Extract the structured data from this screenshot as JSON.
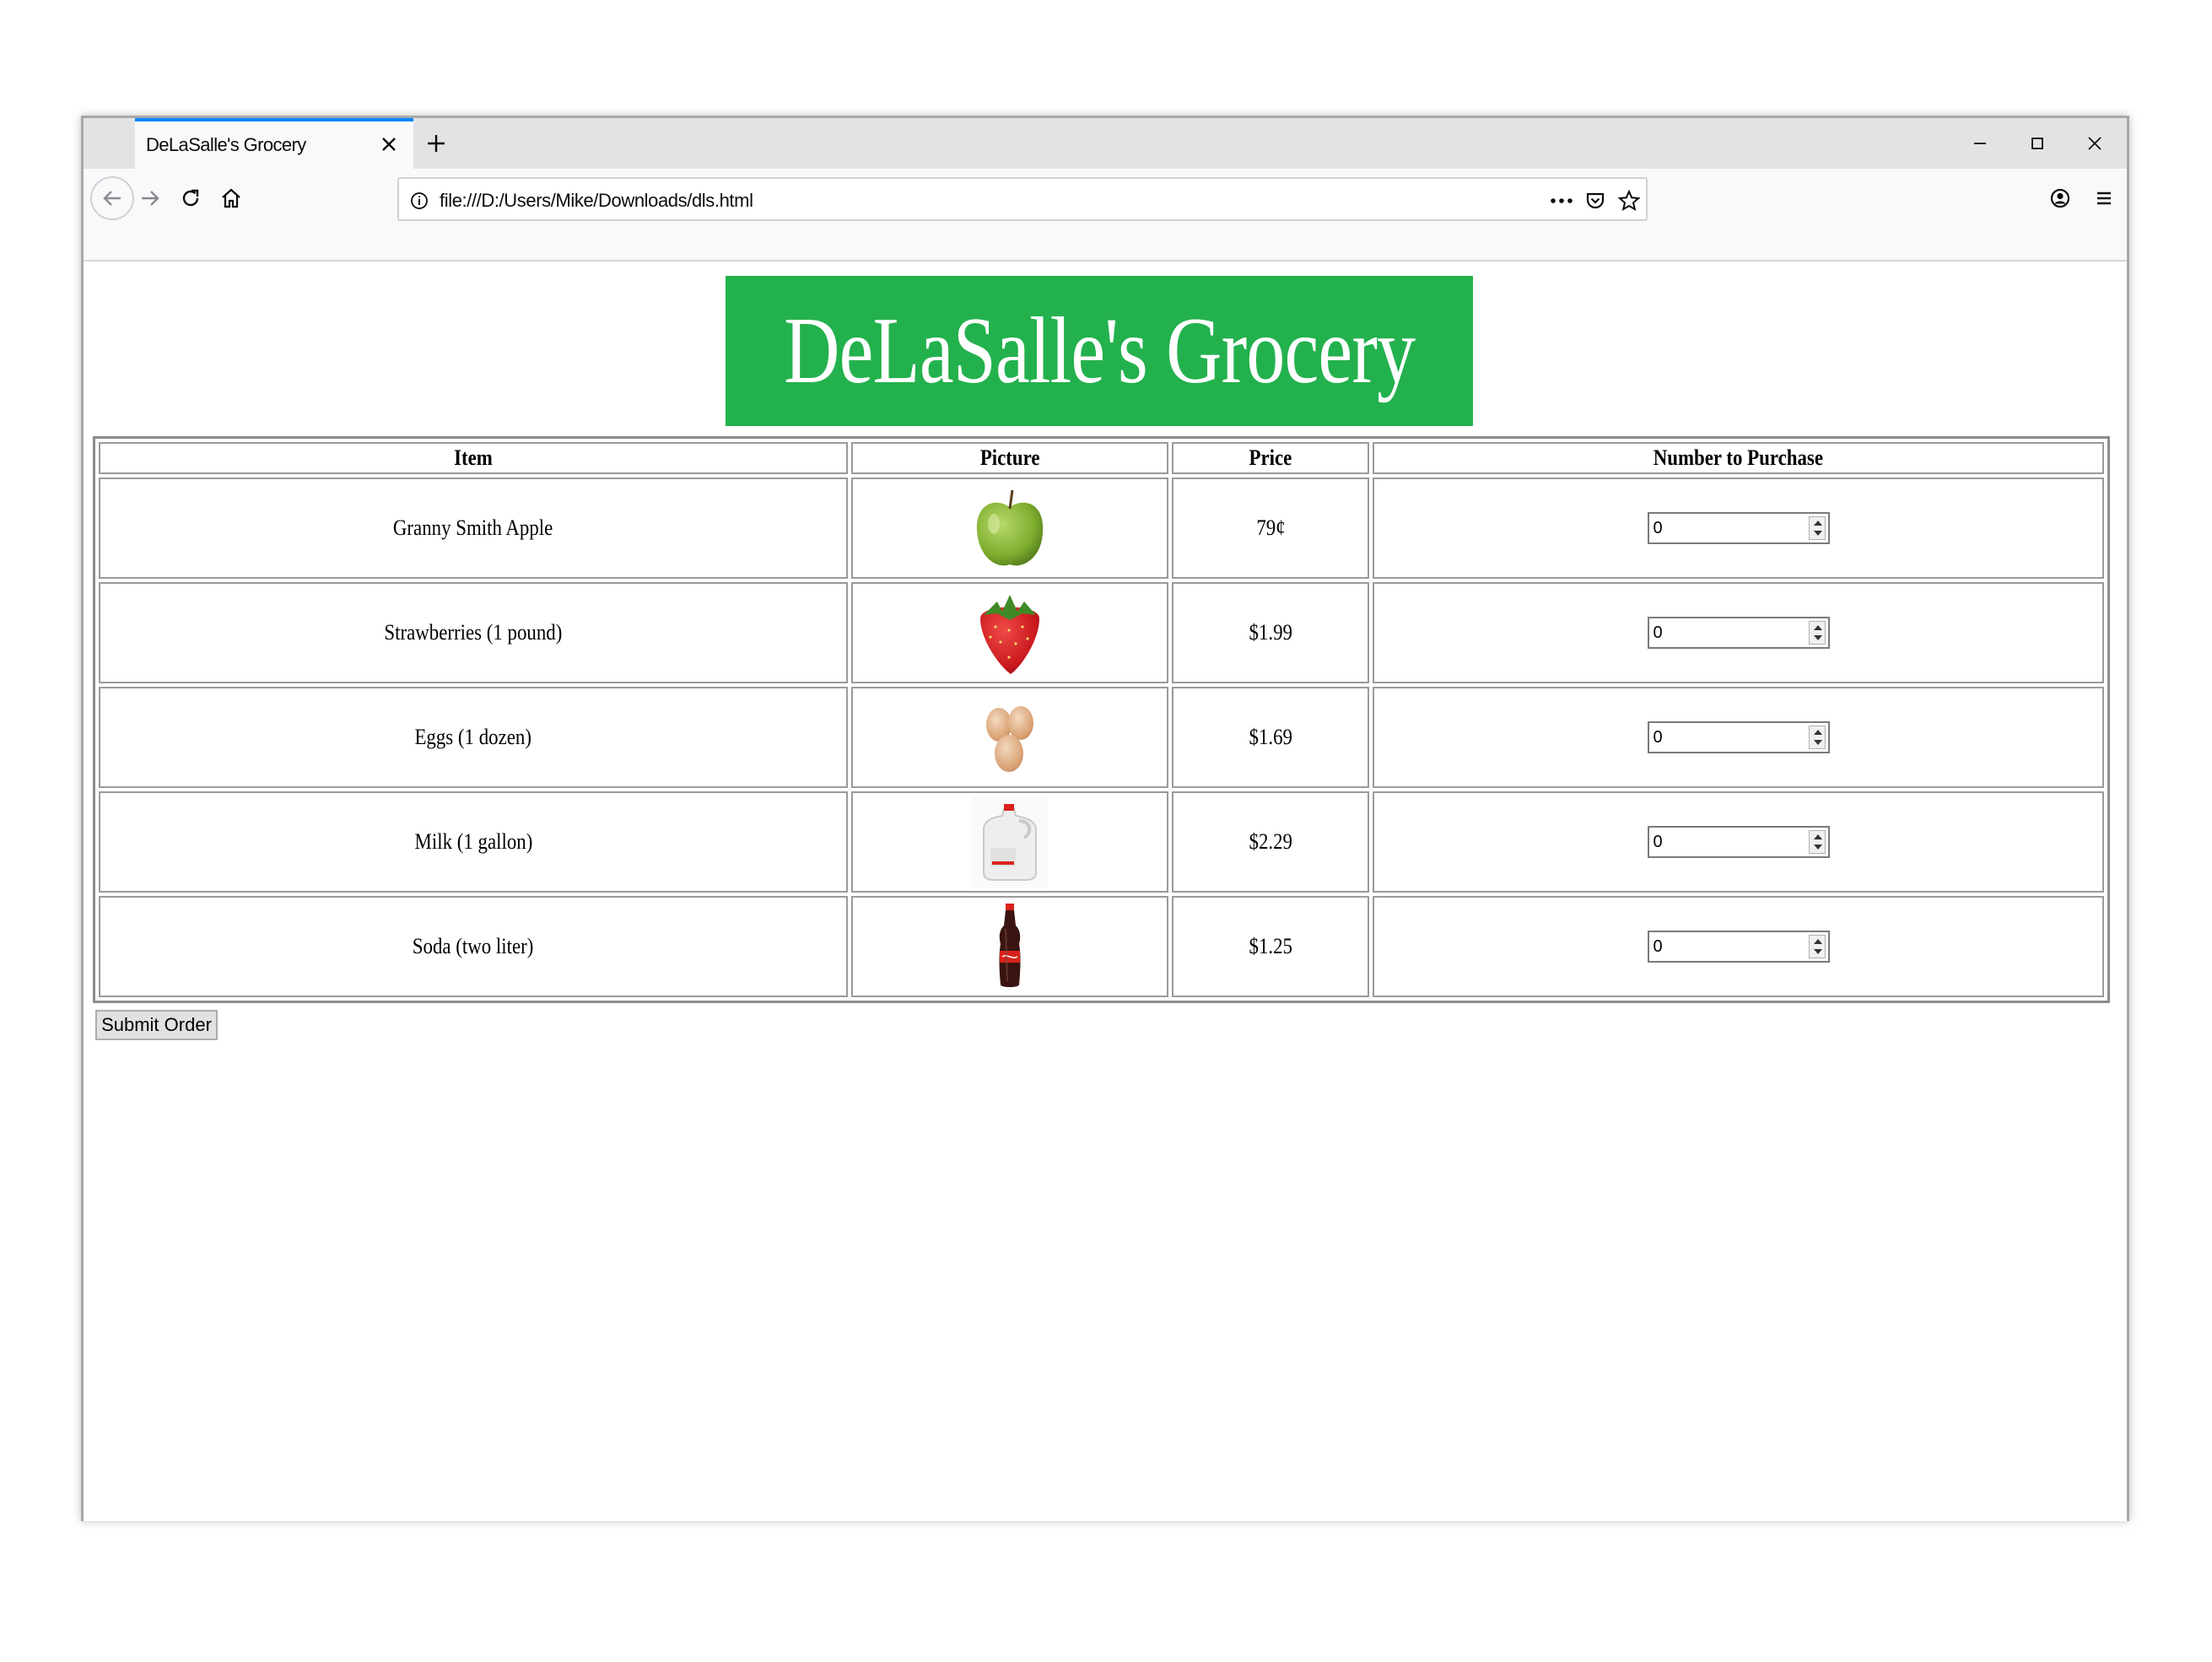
{
  "browser": {
    "tab_title": "DeLaSalle's Grocery",
    "url": "file:///D:/Users/Mike/Downloads/dls.html"
  },
  "page": {
    "banner_title": "DeLaSalle's Grocery",
    "banner_color": "#23b14d",
    "table": {
      "headers": [
        "Item",
        "Picture",
        "Price",
        "Number to Purchase"
      ],
      "rows": [
        {
          "item": "Granny Smith Apple",
          "picture": "green-apple",
          "price": "79¢",
          "quantity": "0"
        },
        {
          "item": "Strawberries (1 pound)",
          "picture": "strawberry",
          "price": "$1.99",
          "quantity": "0"
        },
        {
          "item": "Eggs (1 dozen)",
          "picture": "eggs",
          "price": "$1.69",
          "quantity": "0"
        },
        {
          "item": "Milk (1 gallon)",
          "picture": "milk-jug",
          "price": "$2.29",
          "quantity": "0"
        },
        {
          "item": "Soda (two liter)",
          "picture": "soda-bottle",
          "price": "$1.25",
          "quantity": "0"
        }
      ]
    },
    "submit_label": "Submit Order"
  }
}
